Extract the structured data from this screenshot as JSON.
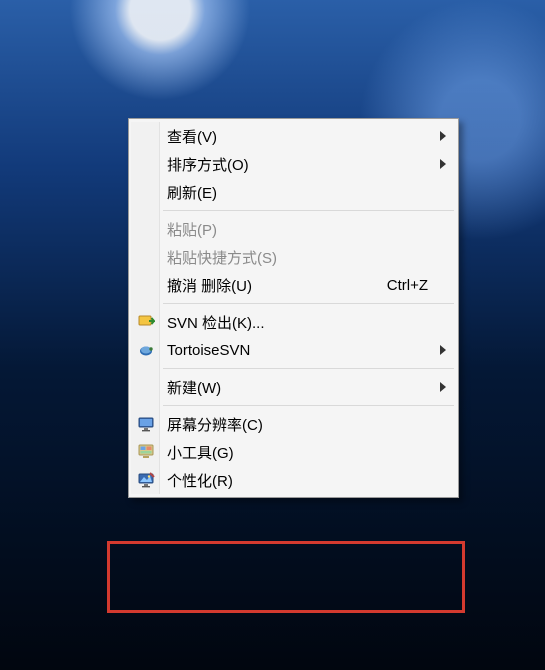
{
  "menu": {
    "view": {
      "label": "查看(V)",
      "hasSubmenu": true
    },
    "sortBy": {
      "label": "排序方式(O)",
      "hasSubmenu": true
    },
    "refresh": {
      "label": "刷新(E)"
    },
    "paste": {
      "label": "粘贴(P)",
      "disabled": true
    },
    "pasteShortcut": {
      "label": "粘贴快捷方式(S)",
      "disabled": true
    },
    "undoDelete": {
      "label": "撤消 删除(U)",
      "shortcut": "Ctrl+Z"
    },
    "svnCheckout": {
      "label": "SVN 检出(K)..."
    },
    "tortoiseSvn": {
      "label": "TortoiseSVN",
      "hasSubmenu": true
    },
    "new": {
      "label": "新建(W)",
      "hasSubmenu": true
    },
    "screenRes": {
      "label": "屏幕分辨率(C)"
    },
    "gadgets": {
      "label": "小工具(G)"
    },
    "personalize": {
      "label": "个性化(R)"
    }
  }
}
